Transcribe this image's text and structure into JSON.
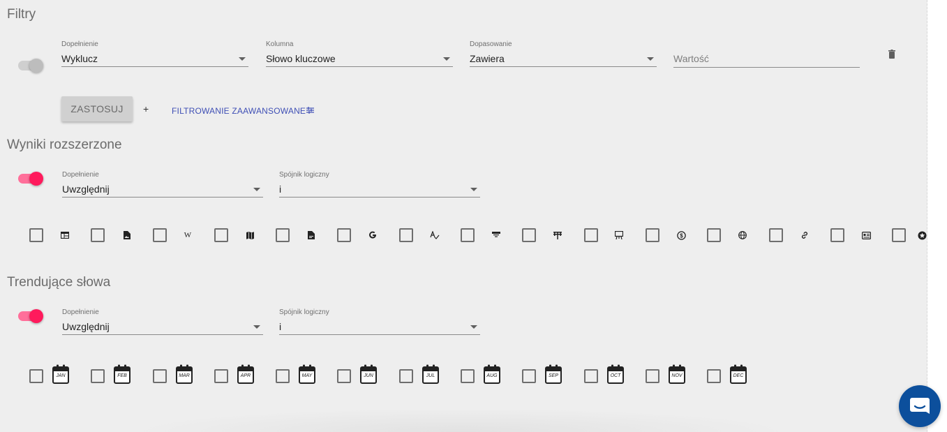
{
  "filters": {
    "title": "Filtry",
    "complement": {
      "label": "Dopełnienie",
      "value": "Wyklucz"
    },
    "column": {
      "label": "Kolumna",
      "value": "Słowo kluczowe"
    },
    "match": {
      "label": "Dopasowanie",
      "value": "Zawiera"
    },
    "value_field": {
      "placeholder": "Wartość",
      "value": ""
    },
    "toggle_on": false,
    "apply_label": "ZASTOSUJ",
    "add_label": "+",
    "advanced_label": "FILTROWANIE ZAAWANSOWANE"
  },
  "extended_results": {
    "title": "Wyniki rozszerzone",
    "toggle_on": true,
    "complement": {
      "label": "Dopełnienie",
      "value": "Uwzględnij"
    },
    "logic": {
      "label": "Spójnik logiczny",
      "value": "i"
    },
    "feature_icons": [
      "table-icon",
      "image-icon",
      "wikipedia-icon",
      "map-icon",
      "document-icon",
      "google-icon",
      "translate-icon",
      "tweet-icon",
      "carousel-icon",
      "presentation-icon",
      "shopping-icon",
      "globe-icon",
      "link-icon",
      "news-icon",
      "star-icon"
    ]
  },
  "trending_words": {
    "title": "Trendujące słowa",
    "toggle_on": true,
    "complement": {
      "label": "Dopełnienie",
      "value": "Uwzględnij"
    },
    "logic": {
      "label": "Spójnik logiczny",
      "value": "i"
    },
    "months": [
      "JAN",
      "FEB",
      "MAR",
      "APR",
      "MAY",
      "JUN",
      "JUL",
      "AUG",
      "SEP",
      "OCT",
      "NOV",
      "DEC"
    ]
  },
  "colors": {
    "accent_pink": "#ff1a5c",
    "link_blue": "#3f4fb5",
    "chat_blue": "#0c4f9c"
  }
}
